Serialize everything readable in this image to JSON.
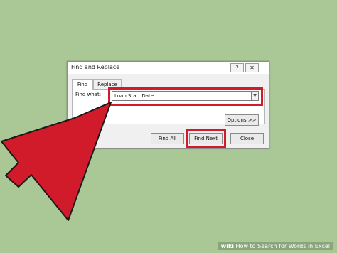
{
  "dialog": {
    "title": "Find and Replace",
    "help_button": "?",
    "close_button": "✕",
    "tabs": [
      {
        "label": "Find",
        "active": true
      },
      {
        "label": "Replace",
        "active": false
      }
    ],
    "find_what_label": "Find what:",
    "find_what_value": "Loan Start Date",
    "options_button": "Options >>",
    "find_all_button": "Find All",
    "find_next_button": "Find Next",
    "close_label": "Close"
  },
  "colors": {
    "background": "#a9c896",
    "highlight": "#d11a2a",
    "arrow": "#d11a2a"
  },
  "watermark": {
    "brand": "wiki",
    "text": "How to Search for Words in Excel"
  }
}
